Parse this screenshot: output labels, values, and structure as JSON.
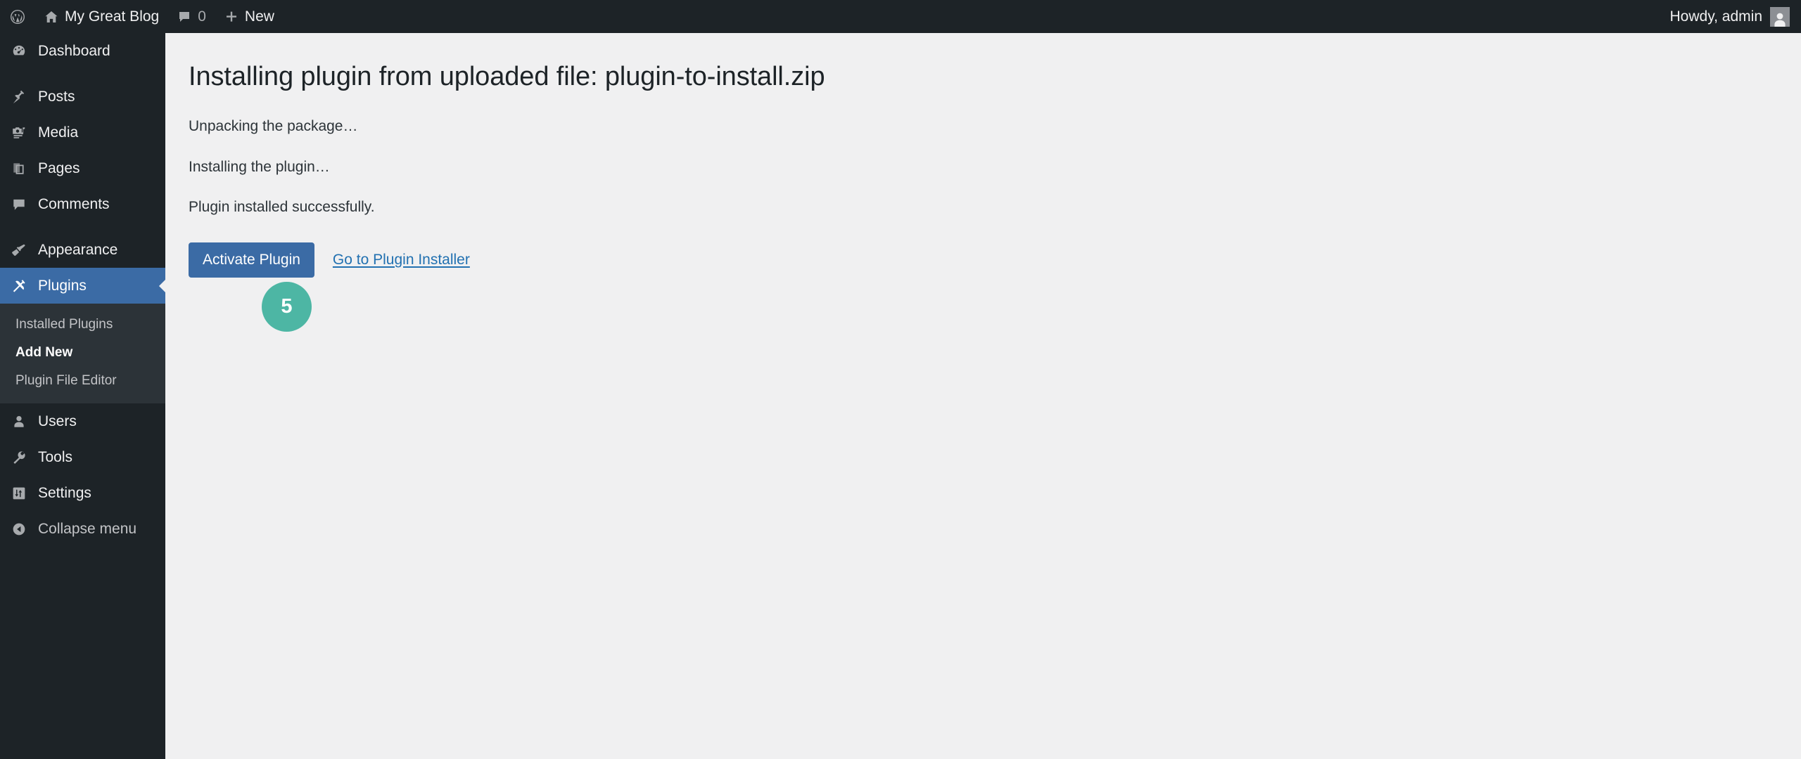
{
  "adminbar": {
    "wp_logo_icon": "wordpress-logo-icon",
    "site_name": "My Great Blog",
    "site_icon": "home-icon",
    "comments_icon": "comment-bubble-icon",
    "comments_count": "0",
    "new_icon": "plus-icon",
    "new_label": "New",
    "howdy": "Howdy, admin",
    "avatar_icon": "user-avatar-icon"
  },
  "sidebar": {
    "items": [
      {
        "label": "Dashboard",
        "icon": "dashboard-gauge-icon",
        "current": false,
        "gap_before": false
      },
      {
        "label": "Posts",
        "icon": "pin-icon",
        "current": false,
        "gap_before": true
      },
      {
        "label": "Media",
        "icon": "media-camera-music-icon",
        "current": false,
        "gap_before": false
      },
      {
        "label": "Pages",
        "icon": "pages-icon",
        "current": false,
        "gap_before": false
      },
      {
        "label": "Comments",
        "icon": "comment-bubble-icon",
        "current": false,
        "gap_before": false
      },
      {
        "label": "Appearance",
        "icon": "paintbrush-icon",
        "current": false,
        "gap_before": true
      },
      {
        "label": "Plugins",
        "icon": "plug-icon",
        "current": true,
        "gap_before": false
      }
    ],
    "submenu": [
      {
        "label": "Installed Plugins",
        "current": false
      },
      {
        "label": "Add New",
        "current": true
      },
      {
        "label": "Plugin File Editor",
        "current": false
      }
    ],
    "items_after": [
      {
        "label": "Users",
        "icon": "user-icon",
        "current": false,
        "gap_before": false
      },
      {
        "label": "Tools",
        "icon": "wrench-icon",
        "current": false,
        "gap_before": false
      },
      {
        "label": "Settings",
        "icon": "settings-sliders-icon",
        "current": false,
        "gap_before": false
      }
    ],
    "collapse": {
      "label": "Collapse menu",
      "icon": "collapse-arrow-left-icon"
    }
  },
  "main": {
    "title": "Installing plugin from uploaded file: plugin-to-install.zip",
    "status_lines": [
      "Unpacking the package…",
      "Installing the plugin…",
      "Plugin installed successfully."
    ],
    "activate_label": "Activate Plugin",
    "installer_link_label": "Go to Plugin Installer",
    "step_badge": "5"
  },
  "colors": {
    "admin_bar_bg": "#1d2327",
    "sidebar_bg": "#1d2327",
    "submenu_bg": "#2c3338",
    "active_blue": "#3b6ba5",
    "content_bg": "#f0f0f1",
    "link_blue": "#2271b1",
    "badge_teal": "#4db6a4",
    "text_light": "#f0f0f1",
    "icon_grey": "#a7aaad"
  }
}
